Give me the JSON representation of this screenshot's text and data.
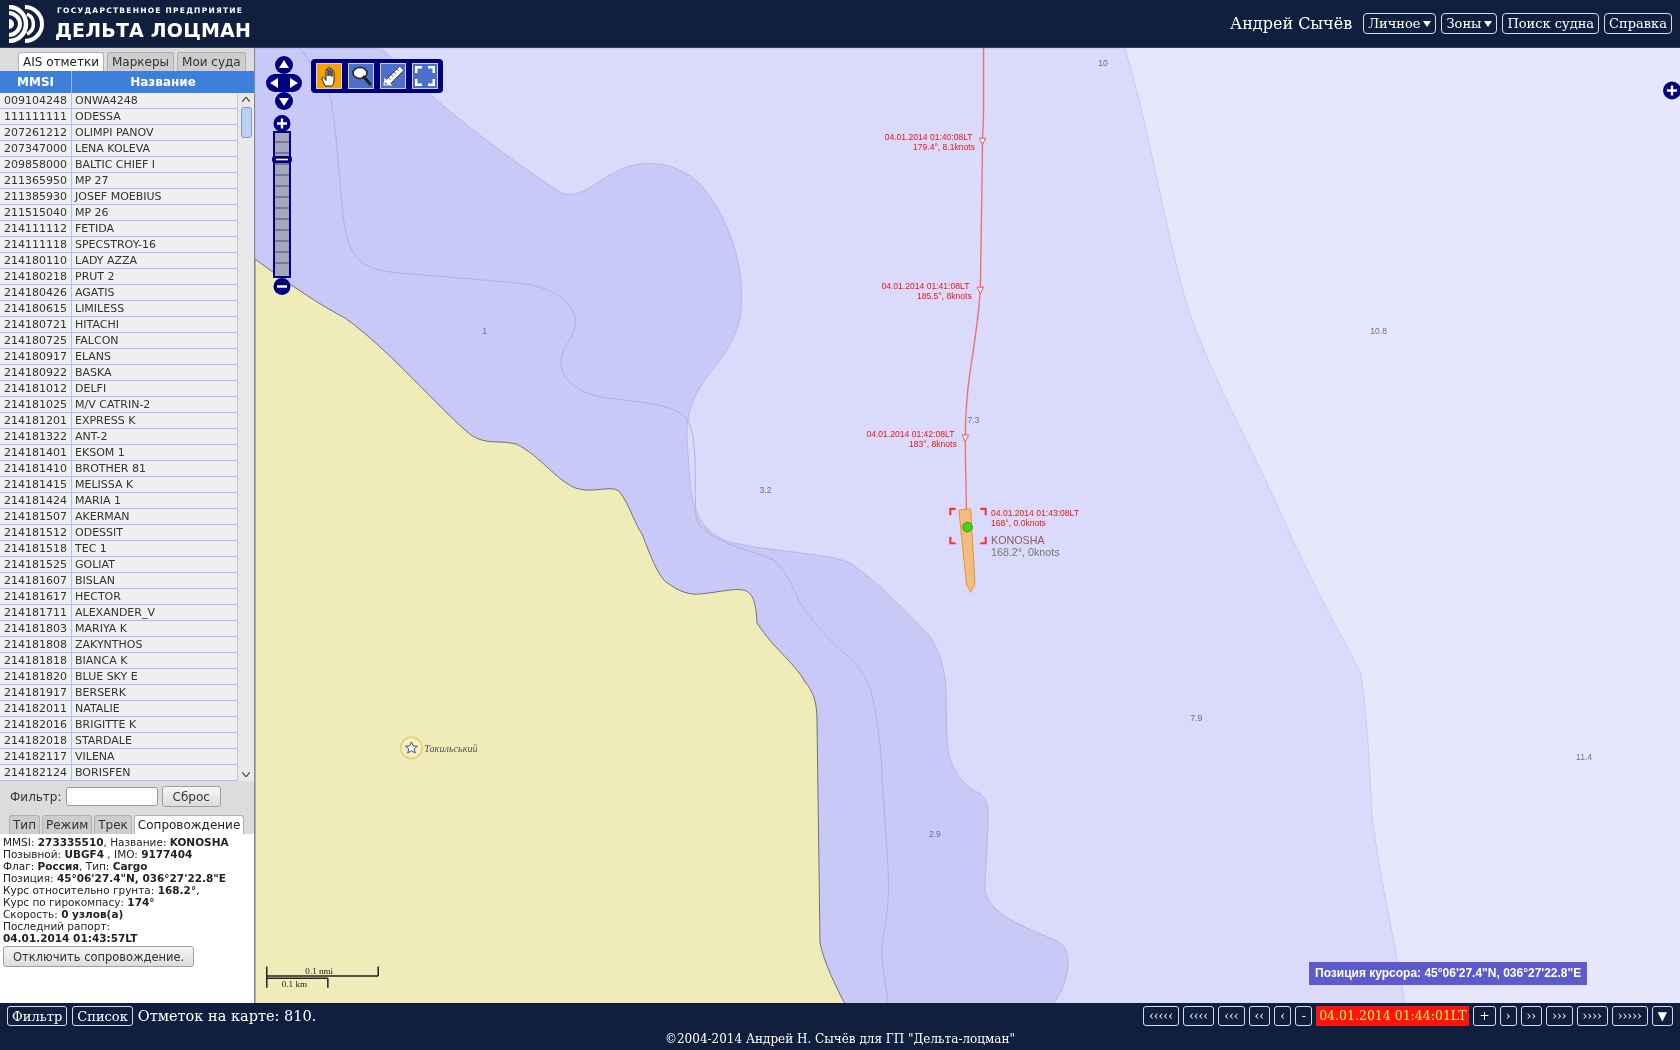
{
  "header": {
    "org_line": "ГОСУДАРСТВЕННОЕ ПРЕДПРИЯТИЕ",
    "brand": "ДЕЛЬТА ЛОЦМАН",
    "user": "Андрей Сычёв",
    "menu": [
      {
        "label": "Личное",
        "kind": "dropdown"
      },
      {
        "label": "Зоны",
        "kind": "dropdown"
      },
      {
        "label": "Поиск судна",
        "kind": "button"
      },
      {
        "label": "Справка",
        "kind": "button"
      }
    ]
  },
  "left_panel": {
    "tabs": [
      {
        "label": "AIS отметки",
        "selected": true
      },
      {
        "label": "Маркеры",
        "selected": false
      },
      {
        "label": "Мои суда",
        "selected": false
      }
    ],
    "table": {
      "columns": [
        "MMSI",
        "Название"
      ],
      "rows": [
        {
          "mmsi": "009104248",
          "name": "ONWA4248",
          "selected": false
        },
        {
          "mmsi": "111111111",
          "name": "ODESSA",
          "selected": false
        },
        {
          "mmsi": "207261212",
          "name": "OLIMPI PANOV",
          "selected": false
        },
        {
          "mmsi": "207347000",
          "name": "LENA KOLEVA",
          "selected": false
        },
        {
          "mmsi": "209858000",
          "name": "BALTIC CHIEF I",
          "selected": false
        },
        {
          "mmsi": "211365950",
          "name": "MP 27",
          "selected": false
        },
        {
          "mmsi": "211385930",
          "name": "JOSEF MOEBIUS",
          "selected": false
        },
        {
          "mmsi": "211515040",
          "name": "MP 26",
          "selected": false
        },
        {
          "mmsi": "214111112",
          "name": "FETIDA",
          "selected": false
        },
        {
          "mmsi": "214111118",
          "name": "SPECSTROY-16",
          "selected": false
        },
        {
          "mmsi": "214180110",
          "name": "LADY AZZA",
          "selected": false
        },
        {
          "mmsi": "214180218",
          "name": "PRUT 2",
          "selected": false
        },
        {
          "mmsi": "214180426",
          "name": "AGATIS",
          "selected": false
        },
        {
          "mmsi": "214180615",
          "name": "LIMILESS",
          "selected": false
        },
        {
          "mmsi": "214180721",
          "name": "HITACHI",
          "selected": false
        },
        {
          "mmsi": "214180725",
          "name": "FALCON",
          "selected": false
        },
        {
          "mmsi": "214180917",
          "name": "ELANS",
          "selected": false
        },
        {
          "mmsi": "214180922",
          "name": "BASKA",
          "selected": false
        },
        {
          "mmsi": "214181012",
          "name": "DELFI",
          "selected": false
        },
        {
          "mmsi": "214181025",
          "name": "M/V CATRIN-2",
          "selected": false
        },
        {
          "mmsi": "214181201",
          "name": "EXPRESS K",
          "selected": false
        },
        {
          "mmsi": "214181322",
          "name": "ANT-2",
          "selected": false
        },
        {
          "mmsi": "214181401",
          "name": "EKSOM 1",
          "selected": false
        },
        {
          "mmsi": "214181410",
          "name": "BROTHER 81",
          "selected": false
        },
        {
          "mmsi": "214181415",
          "name": "MELISSA K",
          "selected": false
        },
        {
          "mmsi": "214181424",
          "name": "MARIA 1",
          "selected": false
        },
        {
          "mmsi": "214181507",
          "name": "AKERMAN",
          "selected": false
        },
        {
          "mmsi": "214181512",
          "name": "ODESSIT",
          "selected": false
        },
        {
          "mmsi": "214181518",
          "name": "TEC 1",
          "selected": false
        },
        {
          "mmsi": "214181525",
          "name": "GOLIAT",
          "selected": false
        },
        {
          "mmsi": "214181607",
          "name": "BISLAN",
          "selected": false
        },
        {
          "mmsi": "214181617",
          "name": "HECTOR",
          "selected": false
        },
        {
          "mmsi": "214181711",
          "name": "ALEXANDER_V",
          "selected": false
        },
        {
          "mmsi": "214181803",
          "name": "MARIYA K",
          "selected": false
        },
        {
          "mmsi": "214181808",
          "name": "ZAKYNTHOS",
          "selected": false
        },
        {
          "mmsi": "214181818",
          "name": "BIANCA K",
          "selected": false
        },
        {
          "mmsi": "214181820",
          "name": "BLUE SKY E",
          "selected": false
        },
        {
          "mmsi": "214181917",
          "name": "BERSERK",
          "selected": false
        },
        {
          "mmsi": "214182011",
          "name": "NATALIE",
          "selected": false
        },
        {
          "mmsi": "214182016",
          "name": "BRIGITTE K",
          "selected": false
        },
        {
          "mmsi": "214182018",
          "name": "STARDALE",
          "selected": false
        },
        {
          "mmsi": "214182117",
          "name": "VILENA",
          "selected": false
        },
        {
          "mmsi": "214182124",
          "name": "BORISFEN",
          "selected": false
        }
      ]
    },
    "filter": {
      "label": "Фильтр:",
      "button": "Сброс"
    },
    "info_tabs": [
      {
        "label": "Тип",
        "selected": false
      },
      {
        "label": "Режим",
        "selected": false
      },
      {
        "label": "Трек",
        "selected": false
      },
      {
        "label": "Сопровождение",
        "selected": true
      }
    ],
    "vessel_info": {
      "lines": [
        {
          "kind": "line",
          "text": "MMSI: **273335510**, Название: **KONOSHA**"
        },
        {
          "kind": "line",
          "text": "Позывной: **UBGF4** , IMO: **9177404**"
        },
        {
          "kind": "line",
          "text": "Флаг: **Россия**, Тип: **Cargo**"
        },
        {
          "kind": "line",
          "text": "Позиция: **45°06'27.4\"N, 036°27'22.8\"E**"
        },
        {
          "kind": "line",
          "text": "Курс относительно грунта: **168.2°**,"
        },
        {
          "kind": "line",
          "text": "Курс по гирокомпасу: **174°**"
        },
        {
          "kind": "line",
          "text": "Скорость: **0 узлов(а)**"
        },
        {
          "kind": "line",
          "text": "Последний рапорт:"
        },
        {
          "kind": "value",
          "text": "04.01.2014 01:43:57LT"
        }
      ],
      "button": "Отключить сопровождение."
    }
  },
  "map": {
    "tools": [
      {
        "kind": "pan",
        "selected": true
      },
      {
        "kind": "zoom",
        "selected": false
      },
      {
        "kind": "measure",
        "selected": false
      },
      {
        "kind": "extent",
        "selected": false
      }
    ],
    "zoom_slider": {
      "level": 0.82
    },
    "depths": [
      "10",
      "1",
      "10.8",
      "7.3",
      "3.2",
      "7.9",
      "11.4",
      "2.9"
    ],
    "place": "Такильський",
    "track": [
      {
        "time": "04.01.2014 01:40:08LT",
        "course": "179.4°, 8.1knots"
      },
      {
        "time": "04.01.2014 01:41:08LT",
        "course": "185.5°, 8knots"
      },
      {
        "time": "04.01.2014 01:42:08LT",
        "course": "183°, 8knots"
      },
      {
        "time": "04.01.2014 01:43:08LT",
        "course": "168°, 0.0knots"
      }
    ],
    "vessel": {
      "name": "KONOSHA",
      "course": "168.2°, 0knots",
      "selected": true
    },
    "scale": {
      "nautical": "0.1 nmi",
      "metric": "0.1 km"
    },
    "cursor_position": "Позиция курсора: 45°06'27.4\"N, 036°27'22.8\"E"
  },
  "status_bar": {
    "buttons": [
      "Фильтр",
      "Список"
    ],
    "count": "Отметок на карте: 810.",
    "back": [
      "‹‹‹‹‹",
      "‹‹‹‹",
      "‹‹‹",
      "‹‹",
      "‹",
      "-"
    ],
    "time": "04.01.2014 01:44:01LT",
    "forward": [
      "+",
      "›",
      "››",
      "›››",
      "››››",
      "›››››",
      "▼"
    ]
  },
  "footer": "©2004-2014 Андрей Н. Сычёв для ГП \"Дельта-лоцман\""
}
